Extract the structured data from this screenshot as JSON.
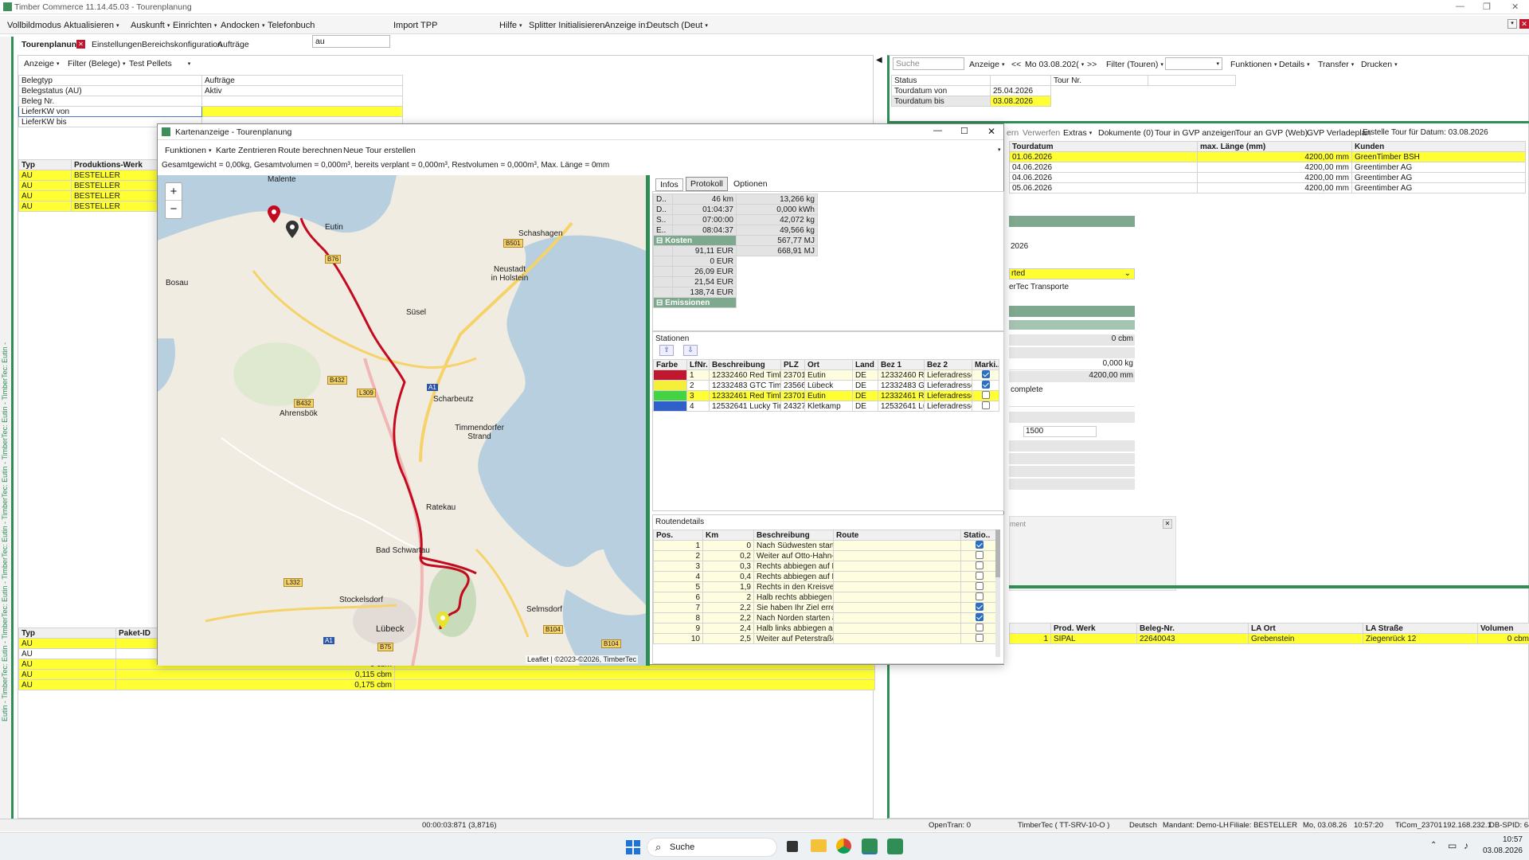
{
  "window": {
    "title": "Timber Commerce 11.14.45.03 - Tourenplanung"
  },
  "menu": {
    "items": [
      "Vollbildmodus",
      "Aktualisieren",
      "Auskunft",
      "Einrichten",
      "Andocken",
      "Telefonbuch"
    ],
    "phonebook_value": "au",
    "import": "Import TPP",
    "hilfe": "Hilfe",
    "splitter": "Splitter Initialisieren",
    "anzeige_in": "Anzeige in:",
    "language": "Deutsch (Deut"
  },
  "tabs": [
    "Tourenplanung",
    "Einstellungen",
    "Bereichskonfiguration",
    "Aufträge"
  ],
  "left": {
    "toolbar": [
      "Anzeige",
      "Filter (Belege)",
      "Test Pellets"
    ],
    "filters": [
      {
        "label": "Belegtyp",
        "value": "Aufträge"
      },
      {
        "label": "Belegstatus (AU)",
        "value": "Aktiv"
      },
      {
        "label": "Beleg Nr.",
        "value": ""
      },
      {
        "label": "LieferKW von",
        "value": ""
      },
      {
        "label": "LieferKW bis",
        "value": ""
      }
    ],
    "grid1": {
      "headers": [
        "Typ",
        "Produktions-Werk"
      ],
      "rows": [
        [
          "AU",
          "BESTELLER"
        ],
        [
          "AU",
          "BESTELLER"
        ],
        [
          "AU",
          "BESTELLER"
        ],
        [
          "AU",
          "BESTELLER"
        ]
      ]
    },
    "grid2": {
      "headers": [
        "Typ",
        "Paket-ID"
      ],
      "rows": [
        [
          "AU",
          "",
          ""
        ],
        [
          "AU",
          "",
          ""
        ],
        [
          "AU",
          "0 cbm",
          ""
        ],
        [
          "AU",
          "0,115 cbm",
          ""
        ],
        [
          "AU",
          "0,175 cbm",
          ""
        ]
      ]
    },
    "vertical_text": "Eutin - TimberTec: Eutin - TimberTec: Eutin - TimberTec: Eutin - TimberTec: Eutin - TimberTec: Eutin - TimberTec: Eutin -"
  },
  "right": {
    "search_placeholder": "Suche",
    "toolbar": [
      "Anzeige",
      "<<",
      "Mo 03.08.202(",
      ">>",
      "Filter (Touren)",
      "",
      "Funktionen",
      "Details",
      "Transfer",
      "Drucken"
    ],
    "filters": [
      {
        "label": "Status",
        "value": "",
        "label2": "Tour Nr.",
        "value2": ""
      },
      {
        "label": "Tourdatum von",
        "value": "25.04.2026"
      },
      {
        "label": "Tourdatum bis",
        "value": "03.08.2026"
      }
    ],
    "actions": [
      "ern",
      "Verwerfen",
      "Extras",
      "Dokumente (0)",
      "Tour in GVP anzeigen",
      "Tour an GVP (Web)",
      "GVP Verladeplan",
      "Erstelle Tour für Datum: 03.08.2026"
    ],
    "tours_headers": [
      "Tourdatum",
      "max. Länge (mm)",
      "Kunden"
    ],
    "tours": [
      [
        "01.06.2026",
        "4200,00 mm",
        "GreenTimber BSH"
      ],
      [
        "04.06.2026",
        "4200,00 mm",
        "Greentimber AG"
      ],
      [
        "04.06.2026",
        "4200,00 mm",
        "Greentimber AG"
      ],
      [
        "05.06.2026",
        "4200,00 mm",
        "Greentimber AG"
      ]
    ],
    "detail": [
      "2026",
      "rted",
      "erTec Transporte",
      "0 cbm",
      "0,000 kg",
      "4200,00 mm",
      "complete",
      "1500"
    ],
    "side_label": "ment",
    "bottom_headers": [
      "Prod. Werk",
      "Beleg-Nr.",
      "LA Ort",
      "LA Straße",
      "Volumen"
    ],
    "bottom_rows": [
      [
        "1",
        "SIPAL",
        "22640043",
        "Grebenstein",
        "Ziegenrück 12",
        "0 cbm"
      ]
    ]
  },
  "dialog": {
    "title": "Kartenanzeige - Tourenplanung",
    "toolbar": [
      "Funktionen",
      "Karte Zentrieren",
      "Route berechnen",
      "Neue Tour erstellen"
    ],
    "summary": "Gesamtgewicht = 0,00kg, Gesamtvolumen = 0,000m³, bereits verplant = 0,000m³, Restvolumen = 0,000m³, Max. Länge = 0mm",
    "map_attr": "Leaflet | ©2023-©2026, TimberTec",
    "zoom_in": "+",
    "zoom_out": "−",
    "places": [
      "Malente",
      "Eutin",
      "Schashagen",
      "Bosau",
      "Neustadt in Holstein",
      "Süsel",
      "Scharbeutz",
      "Ahrensbök",
      "Timmendorfer Strand",
      "Ratekau",
      "Bad Schwartau",
      "Stockelsdorf",
      "Lübeck",
      "Selmsdorf"
    ],
    "roads": [
      "B501",
      "B76",
      "B432",
      "L309",
      "B432",
      "A1",
      "L332",
      "B75",
      "A1",
      "B104",
      "B104"
    ],
    "info_tabs": [
      "Infos",
      "Protokoll",
      "Optionen"
    ],
    "info_rows": [
      [
        "D..",
        "46 km",
        "13,266 kg"
      ],
      [
        "D..",
        "01:04:37",
        "0,000 kWh"
      ],
      [
        "S..",
        "07:00:00",
        "42,072 kg"
      ],
      [
        "E..",
        "08:04:37",
        "49,566 kg"
      ],
      [
        "",
        "",
        "567,77 MJ"
      ]
    ],
    "kosten_label": "Kosten",
    "kosten": [
      "91,11 EUR",
      "0 EUR",
      "26,09 EUR",
      "21,54 EUR",
      "138,74 EUR"
    ],
    "kosten_extra": "668,91 MJ",
    "emissionen_label": "Emissionen",
    "stationen_label": "Stationen",
    "stationen_headers": [
      "Farbe",
      "LfNr.",
      "Beschreibung",
      "PLZ",
      "Ort",
      "Land",
      "Bez 1",
      "Bez 2",
      "Marki.."
    ],
    "stationen": [
      {
        "color": "#c0172e",
        "nr": "1",
        "desc": "12332460 Red Timber",
        "plz": "23701",
        "ort": "Eutin",
        "land": "DE",
        "bez1": "12332460 Red",
        "bez2": "Lieferadresse",
        "checked": true
      },
      {
        "color": "#f4f03a",
        "nr": "2",
        "desc": "12332483 GTC Timber",
        "plz": "23566",
        "ort": "Lübeck",
        "land": "DE",
        "bez1": "12332483 GTC",
        "bez2": "Lieferadresse",
        "checked": true
      },
      {
        "color": "#43d443",
        "nr": "3",
        "desc": "12332461 Red Timber",
        "plz": "23701",
        "ort": "Eutin",
        "land": "DE",
        "bez1": "12332461 Red",
        "bez2": "Lieferadresse",
        "checked": false
      },
      {
        "color": "#2f5fc8",
        "nr": "4",
        "desc": "12532641 Lucky Timb",
        "plz": "24327",
        "ort": "Kletkamp",
        "land": "DE",
        "bez1": "12532641 Lucl",
        "bez2": "Lieferadresse",
        "checked": false
      }
    ],
    "routen_label": "Routendetails",
    "routen_headers": [
      "Pos.",
      "Km",
      "Beschreibung",
      "Route",
      "Statio.."
    ],
    "routen": [
      [
        "1",
        "0",
        "Nach Südwesten starten",
        true
      ],
      [
        "2",
        "0,2",
        "Weiter auf Otto-Hahn-S",
        false
      ],
      [
        "3",
        "0,3",
        "Rechts abbiegen auf Lou",
        false
      ],
      [
        "4",
        "0,4",
        "Rechts abbiegen auf Lüt",
        false
      ],
      [
        "5",
        "1,9",
        "Rechts in den Kreisverke",
        false
      ],
      [
        "6",
        "2",
        "Halb rechts abbiegen au",
        false
      ],
      [
        "7",
        "2,2",
        "Sie haben Ihr Ziel erreich",
        true
      ],
      [
        "8",
        "2,2",
        "Nach Norden starten au",
        true
      ],
      [
        "9",
        "2,4",
        "Halb links abbiegen auf",
        false
      ],
      [
        "10",
        "2,5",
        "Weiter auf Peterstraße",
        false
      ]
    ]
  },
  "statusbar": {
    "time": "00:00:03:871 (3,8716)",
    "opentran": "OpenTran: 0",
    "server": "TimberTec ( TT-SRV-10-O )",
    "lang": "Deutsch",
    "mandant": "Mandant: Demo-LH",
    "filiale": "Filiale: BESTELLER",
    "date": "Mo, 03.08.26",
    "clock": "10:57:20",
    "ticom": "TiCom_23701",
    "ip": "192.168.232.1",
    "db": "DB-SPID: 64"
  },
  "taskbar": {
    "search": "Suche",
    "time": "10:57",
    "date": "03.08.2026"
  }
}
